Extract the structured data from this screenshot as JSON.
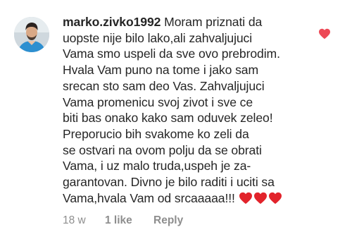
{
  "comment": {
    "username": "marko.zivko1992",
    "text_lines": [
      " Moram priznati da",
      "uopste nije bilo lako,ali zahvaljujuci",
      "Vama smo uspeli da sve ovo prebrodim.",
      "Hvala Vam puno na tome i jako sam",
      "srecan sto sam deo Vas. Zahvaljujuci",
      "Vama promenicu svoj zivot i sve ce",
      "biti bas onako kako sam oduvek zeleo!",
      "Preporucio bih svakome ko zeli da",
      "se ostvari na ovom polju da se obrati",
      "Vama, i uz malo truda,uspeh je za-",
      "garantovan. Divno je bilo raditi i uciti sa",
      "Vama,hvala Vam od srcaaaaa!!! "
    ],
    "time": "18 w",
    "likes": "1 like",
    "reply": "Reply",
    "heart_color": "#ed4956",
    "emoji_hearts_count": 3
  }
}
